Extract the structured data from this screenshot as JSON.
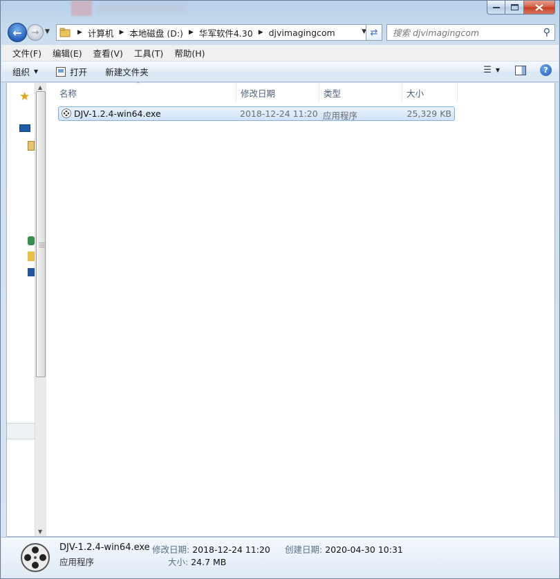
{
  "window": {
    "controls": {
      "minimize": "—",
      "maximize": "□",
      "close": "✕"
    }
  },
  "nav": {
    "back_icon": "back-arrow-icon",
    "forward_icon": "forward-arrow-icon",
    "breadcrumbs": [
      "计算机",
      "本地磁盘 (D:)",
      "华军软件4.30",
      "djvimagingcom"
    ],
    "search_placeholder": "搜索 djvimagingcom"
  },
  "menu": [
    "文件(F)",
    "编辑(E)",
    "查看(V)",
    "工具(T)",
    "帮助(H)"
  ],
  "toolbar": {
    "organize": "组织",
    "open": "打开",
    "new_folder": "新建文件夹"
  },
  "columns": [
    "名称",
    "修改日期",
    "类型",
    "大小"
  ],
  "files": [
    {
      "name": "DJV-1.2.4-win64.exe",
      "date": "2018-12-24 11:20",
      "type": "应用程序",
      "size": "25,329 KB"
    }
  ],
  "details": {
    "name": "DJV-1.2.4-win64.exe",
    "type": "应用程序",
    "modified_label": "修改日期:",
    "modified_value": "2018-12-24 11:20",
    "size_label": "大小:",
    "size_value": "24.7 MB",
    "created_label": "创建日期:",
    "created_value": "2020-04-30 10:31"
  },
  "colors": {
    "accent": "#3a6fc1",
    "selection": "#cfe3fa",
    "close": "#c33e22"
  }
}
